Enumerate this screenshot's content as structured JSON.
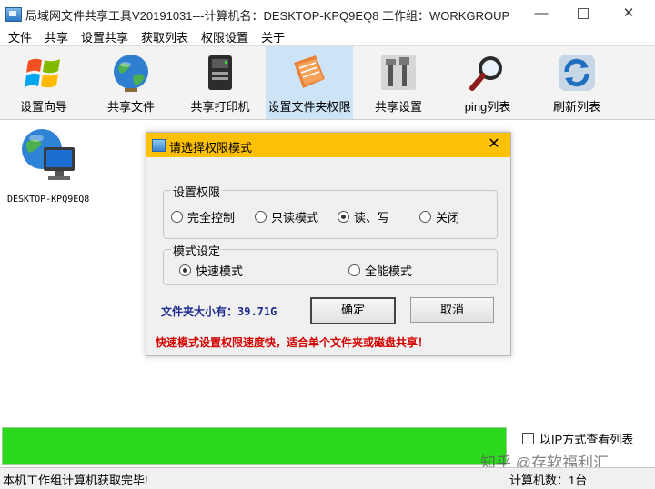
{
  "window": {
    "title": "局域网文件共享工具V20191031---计算机名：DESKTOP-KPQ9EQ8  工作组：WORKGROUP",
    "min_glyph": "—",
    "close_glyph": "✕"
  },
  "menu": [
    "文件",
    "共享",
    "设置共享",
    "获取列表",
    "权限设置",
    "关于"
  ],
  "toolbar": [
    {
      "label": "设置向导",
      "icon": "windows-logo-icon"
    },
    {
      "label": "共享文件",
      "icon": "globe-icon"
    },
    {
      "label": "共享打印机",
      "icon": "printer-icon"
    },
    {
      "label": "设置文件夹权限",
      "icon": "folder-permission-icon",
      "active": true
    },
    {
      "label": "共享设置",
      "icon": "tools-icon"
    },
    {
      "label": "ping列表",
      "icon": "magnifier-icon"
    },
    {
      "label": "刷新列表",
      "icon": "refresh-icon"
    }
  ],
  "computer": {
    "name": "DESKTOP-KPQ9EQ8"
  },
  "dialog": {
    "title": "请选择权限模式",
    "close_glyph": "✕",
    "permission_group": {
      "label": "设置权限",
      "options": [
        {
          "label": "完全控制",
          "checked": false
        },
        {
          "label": "只读模式",
          "checked": false
        },
        {
          "label": "读、写",
          "checked": true
        },
        {
          "label": "关闭",
          "checked": false
        }
      ]
    },
    "mode_group": {
      "label": "模式设定",
      "options": [
        {
          "label": "快速模式",
          "checked": true
        },
        {
          "label": "全能模式",
          "checked": false
        }
      ]
    },
    "size_text": "文件夹大小有：39.71G",
    "ok_label": "确定",
    "cancel_label": "取消",
    "tip": "快速模式设置权限速度快，适合单个文件夹或磁盘共享！"
  },
  "progress": {
    "percent": 100,
    "color": "#2bd81d"
  },
  "options": {
    "ip_view_label": "以IP方式查看列表",
    "ip_view_checked": false
  },
  "status": {
    "left": "本机工作组计算机获取完毕!",
    "right": "计算机数：1台"
  },
  "watermark": "知乎 @存软福利汇",
  "colors": {
    "dialog_title": "#ffc107",
    "tip_text": "#d40000",
    "size_text": "#1e2b8c",
    "active_tool": "#cde4f7"
  }
}
